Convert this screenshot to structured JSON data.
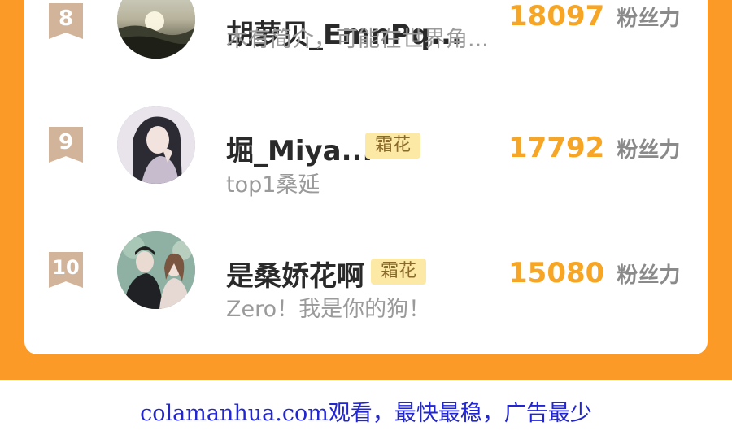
{
  "leaderboard": {
    "unit_label": "粉丝力",
    "rows": [
      {
        "rank": "8",
        "name": "胡萝贝_EmnPq...",
        "badge": "",
        "desc": "木有简介，可能在世界角...",
        "fans": "18097",
        "avatar": "sunset-landscape-avatar"
      },
      {
        "rank": "9",
        "name": "堀_Miya...",
        "badge": "霜花",
        "desc": "top1桑延",
        "fans": "17792",
        "avatar": "anime-girl-avatar"
      },
      {
        "rank": "10",
        "name": "是桑娇花啊",
        "badge": "霜花",
        "desc": "Zero！我是你的狗！",
        "fans": "15080",
        "avatar": "anime-couple-avatar"
      }
    ]
  },
  "footer": {
    "text": "colamanhua.com观看，最快最稳，广告最少"
  },
  "colors": {
    "background_orange": "#fb9a26",
    "fans_number": "#f6a524",
    "badge_bg": "#fbe9a5",
    "rank_badge": "#d2b49a",
    "footer_link": "#2226d0"
  }
}
